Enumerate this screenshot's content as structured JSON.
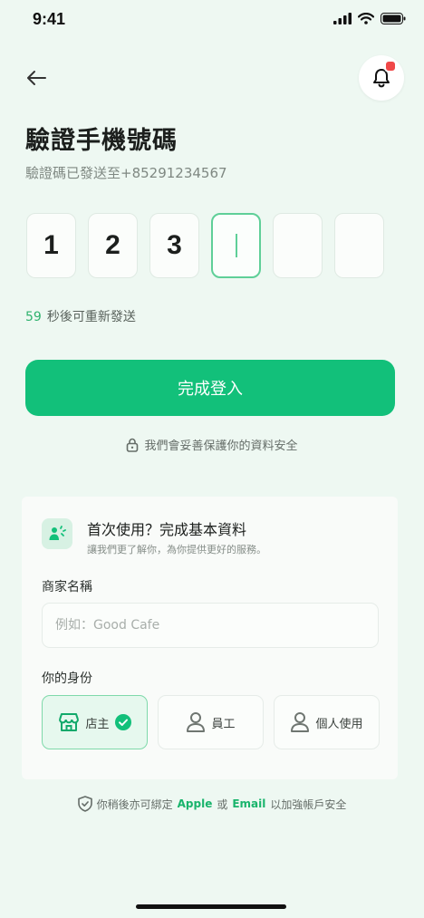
{
  "status": {
    "time": "9:41"
  },
  "header": {
    "title": "驗證手機號碼",
    "subtitle": "驗證碼已發送至+85291234567"
  },
  "otp": {
    "digits": [
      "1",
      "2",
      "3",
      "",
      "",
      ""
    ]
  },
  "resend": {
    "count": "59",
    "text": "秒後可重新發送"
  },
  "actions": {
    "login_label": "完成登入"
  },
  "secure_note": "我們會妥善保護你的資料安全",
  "profile": {
    "title": "首次使用？完成基本資料",
    "subtitle": "讓我們更了解你，為你提供更好的服務。",
    "name_label": "商家名稱",
    "name_placeholder": "例如：Good Cafe",
    "name_value": "",
    "role_label": "你的身份",
    "roles": [
      {
        "label": "店主",
        "selected": true
      },
      {
        "label": "員工",
        "selected": false
      },
      {
        "label": "個人使用",
        "selected": false
      }
    ]
  },
  "footer": {
    "prefix": "你稍後亦可綁定",
    "apple": "Apple",
    "or": "或",
    "email": "Email",
    "suffix": "以加強帳戶安全"
  },
  "colors": {
    "accent": "#12c07a",
    "background": "#eef8f2",
    "notification_dot": "#f04848"
  }
}
